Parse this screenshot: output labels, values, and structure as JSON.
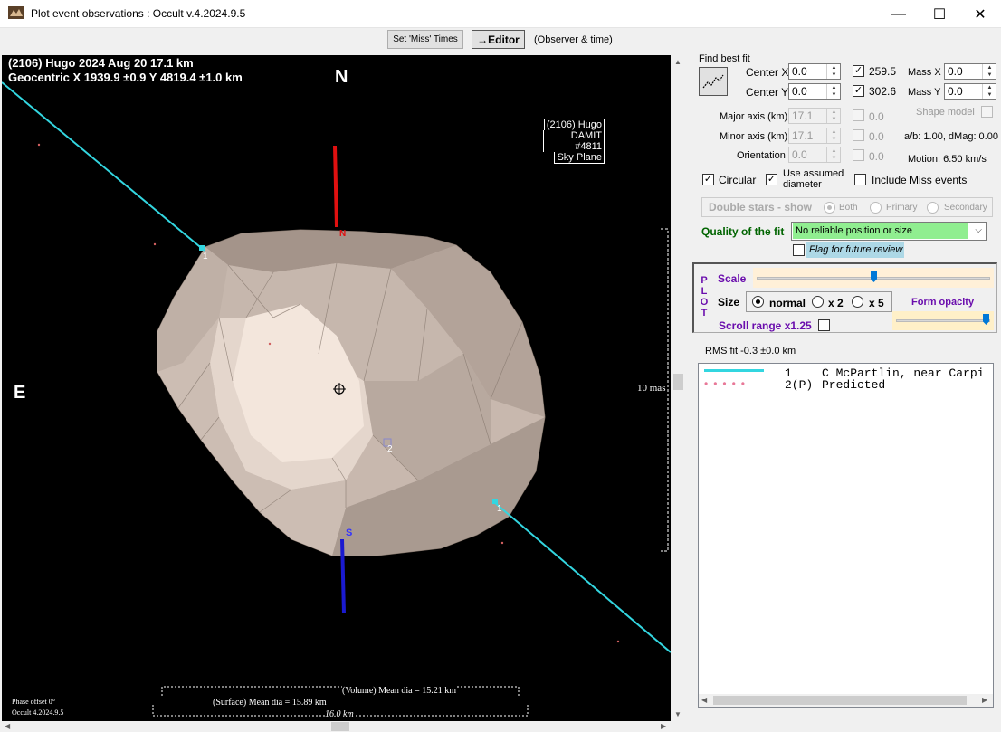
{
  "window": {
    "title": "Plot event observations : Occult v.4.2024.9.5",
    "min_glyph": "—",
    "max_glyph": "☐",
    "close_glyph": "✕"
  },
  "toolbar": {
    "set_miss_times": "Set 'Miss' Times",
    "editor": "→Editor",
    "observer_time": "(Observer & time)"
  },
  "plot": {
    "header_line1": "(2106) Hugo  2024 Aug 20   17.1 km",
    "header_line2": "Geocentric  X  1939.9 ±0.9  Y 4819.4 ±1.0 km",
    "north": "N",
    "east": "E",
    "south_marker": "S",
    "north_marker": "N",
    "model_label1": "(2106) Hugo",
    "model_label2": "DAMIT #4811",
    "model_label3": "Sky Plane",
    "scale_label": "10 mas",
    "chord_label": "1",
    "star2_label": "2",
    "volume_dia": "(Volume) Mean dia = 15.21 km",
    "surface_dia": "(Surface) Mean dia = 15.89 km",
    "scale_km": "16.0 km",
    "phase_offset": "Phase offset 0°",
    "version": "Occult 4.2024.9.5"
  },
  "panel": {
    "find_best_fit": "Find best fit",
    "center_x_label": "Center X",
    "center_x": "0.0",
    "center_y_label": "Center Y",
    "center_y": "0.0",
    "angle1": "259.5",
    "angle2": "302.6",
    "mass_x_label": "Mass X",
    "mass_x": "0.0",
    "mass_y_label": "Mass Y",
    "mass_y": "0.0",
    "major_axis_label": "Major axis (km)",
    "major_axis": "17.1",
    "major_axis_d": "0.0",
    "minor_axis_label": "Minor axis (km)",
    "minor_axis": "17.1",
    "minor_axis_d": "0.0",
    "orientation_label": "Orientation",
    "orientation": "0.0",
    "orientation_d": "0.0",
    "shape_model": "Shape model",
    "ab_dmag": "a/b: 1.00, dMag: 0.00",
    "motion": "Motion: 6.50 km/s",
    "circular": "Circular",
    "use_assumed_1": "Use assumed",
    "use_assumed_2": "diameter",
    "include_miss": "Include Miss events",
    "double_stars": "Double stars - show",
    "both": "Both",
    "primary": "Primary",
    "secondary": "Secondary",
    "quality_label": "Quality of the fit",
    "quality_value": "No reliable position or size",
    "flag_review": "Flag for future review",
    "plot_letters": [
      "P",
      "L",
      "O",
      "T"
    ],
    "scale_label": "Scale",
    "size_label": "Size",
    "size_normal": "normal",
    "size_x2": "x 2",
    "size_x5": "x 5",
    "form_opacity": "Form opacity",
    "scroll_range": "Scroll range x1.25",
    "rms_fit": "RMS fit -0.3 ±0.0 km"
  },
  "legend": {
    "rows": [
      {
        "num": "1",
        "text": "C McPartlin, near Carpi"
      },
      {
        "num": "2(P)",
        "text": "Predicted"
      }
    ]
  },
  "colors": {
    "chord": "#33d6e0",
    "north_axis": "#e01010",
    "south_axis": "#1a1ad0",
    "quality_bg": "#90ee90",
    "flag_bg": "#add8e6",
    "form_opacity_bg": "#fff0c8",
    "scale_bg": "#fff0d8"
  }
}
